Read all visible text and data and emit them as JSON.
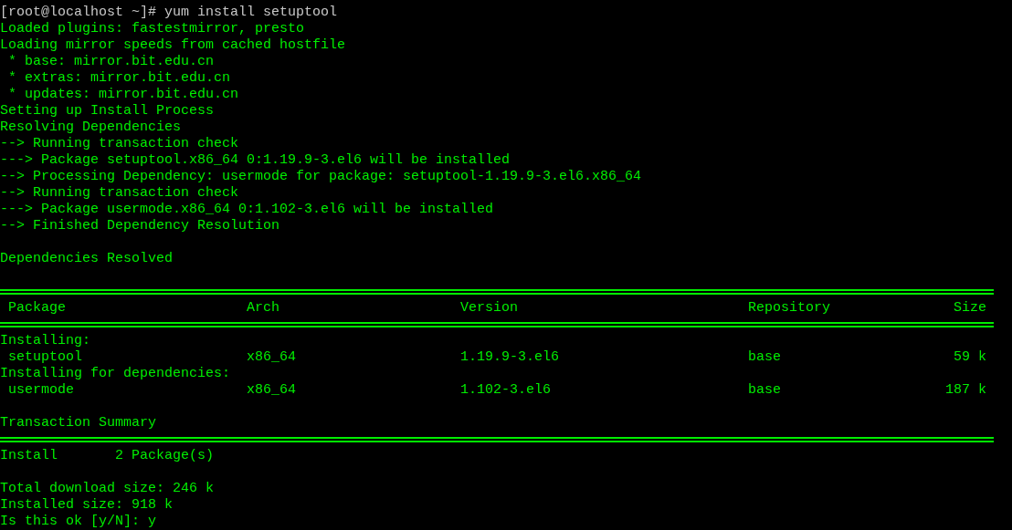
{
  "terminal": {
    "lines": [
      {
        "kind": "prompt",
        "text": "[root@localhost ~]# yum install setuptool"
      },
      {
        "kind": "output",
        "text": "Loaded plugins: fastestmirror, presto"
      },
      {
        "kind": "output",
        "text": "Loading mirror speeds from cached hostfile"
      },
      {
        "kind": "output",
        "text": " * base: mirror.bit.edu.cn"
      },
      {
        "kind": "output",
        "text": " * extras: mirror.bit.edu.cn"
      },
      {
        "kind": "output",
        "text": " * updates: mirror.bit.edu.cn"
      },
      {
        "kind": "output",
        "text": "Setting up Install Process"
      },
      {
        "kind": "output",
        "text": "Resolving Dependencies"
      },
      {
        "kind": "output",
        "text": "--> Running transaction check"
      },
      {
        "kind": "output",
        "text": "---> Package setuptool.x86_64 0:1.19.9-3.el6 will be installed"
      },
      {
        "kind": "output",
        "text": "--> Processing Dependency: usermode for package: setuptool-1.19.9-3.el6.x86_64"
      },
      {
        "kind": "output",
        "text": "--> Running transaction check"
      },
      {
        "kind": "output",
        "text": "---> Package usermode.x86_64 0:1.102-3.el6 will be installed"
      },
      {
        "kind": "output",
        "text": "--> Finished Dependency Resolution"
      },
      {
        "kind": "blank"
      },
      {
        "kind": "output",
        "text": "Dependencies Resolved"
      },
      {
        "kind": "blank"
      },
      {
        "kind": "rule"
      },
      {
        "kind": "table_header",
        "cells": [
          "Package",
          "Arch",
          "Version",
          "Repository",
          "Size"
        ]
      },
      {
        "kind": "rule"
      },
      {
        "kind": "output",
        "text": "Installing:"
      },
      {
        "kind": "table_row",
        "cells": [
          "setuptool",
          "x86_64",
          "1.19.9-3.el6",
          "base",
          "59 k"
        ]
      },
      {
        "kind": "output",
        "text": "Installing for dependencies:"
      },
      {
        "kind": "table_row",
        "cells": [
          "usermode",
          "x86_64",
          "1.102-3.el6",
          "base",
          "187 k"
        ]
      },
      {
        "kind": "blank"
      },
      {
        "kind": "output",
        "text": "Transaction Summary"
      },
      {
        "kind": "rule"
      },
      {
        "kind": "output",
        "text": "Install       2 Package(s)"
      },
      {
        "kind": "blank"
      },
      {
        "kind": "output",
        "text": "Total download size: 246 k"
      },
      {
        "kind": "output",
        "text": "Installed size: 918 k"
      },
      {
        "kind": "output",
        "text": "Is this ok [y/N]: y"
      }
    ]
  }
}
